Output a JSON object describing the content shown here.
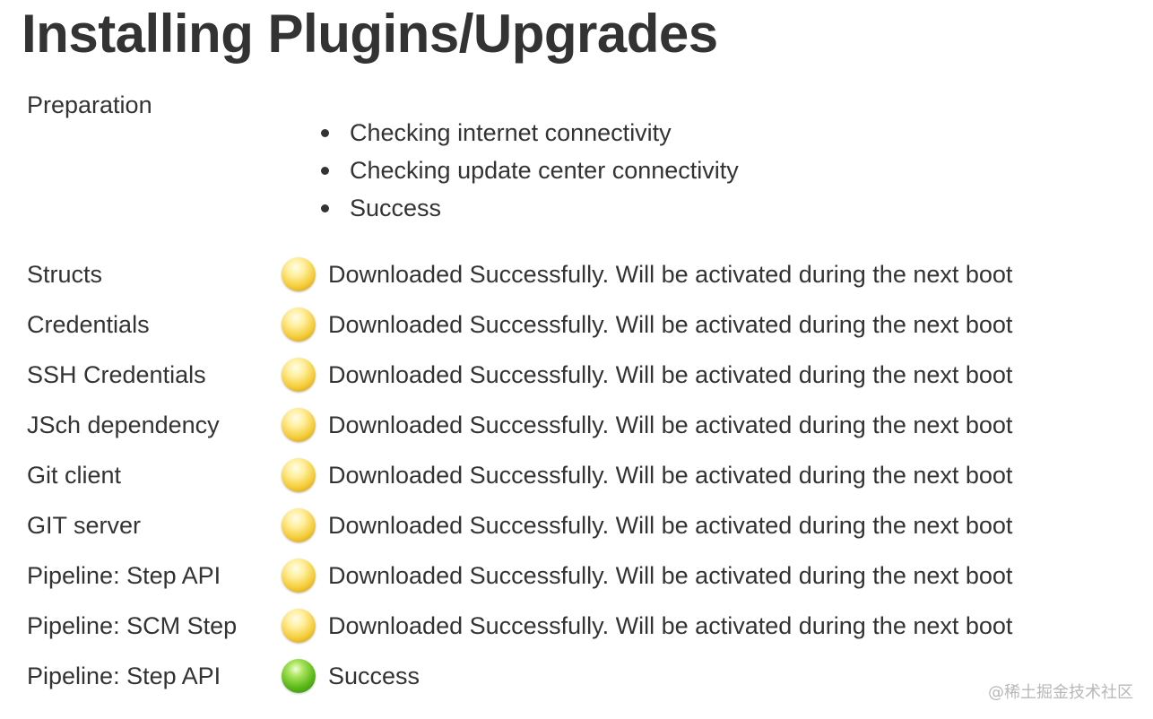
{
  "page": {
    "title": "Installing Plugins/Upgrades"
  },
  "preparation": {
    "label": "Preparation",
    "steps": [
      "Checking internet connectivity",
      "Checking update center connectivity",
      "Success"
    ]
  },
  "plugins": [
    {
      "name": "Structs",
      "status": "Downloaded Successfully. Will be activated during the next boot",
      "icon": "yellow-ball-icon",
      "color": "#f4cd3a"
    },
    {
      "name": "Credentials",
      "status": "Downloaded Successfully. Will be activated during the next boot",
      "icon": "yellow-ball-icon",
      "color": "#f4cd3a"
    },
    {
      "name": "SSH Credentials",
      "status": "Downloaded Successfully. Will be activated during the next boot",
      "icon": "yellow-ball-icon",
      "color": "#f4cd3a"
    },
    {
      "name": "JSch dependency",
      "status": "Downloaded Successfully. Will be activated during the next boot",
      "icon": "yellow-ball-icon",
      "color": "#f4cd3a"
    },
    {
      "name": "Git client",
      "status": "Downloaded Successfully. Will be activated during the next boot",
      "icon": "yellow-ball-icon",
      "color": "#f4cd3a"
    },
    {
      "name": "GIT server",
      "status": "Downloaded Successfully. Will be activated during the next boot",
      "icon": "yellow-ball-icon",
      "color": "#f4cd3a"
    },
    {
      "name": "Pipeline: Step API",
      "status": "Downloaded Successfully. Will be activated during the next boot",
      "icon": "yellow-ball-icon",
      "color": "#f4cd3a"
    },
    {
      "name": "Pipeline: SCM Step",
      "status": "Downloaded Successfully. Will be activated during the next boot",
      "icon": "yellow-ball-icon",
      "color": "#f4cd3a"
    },
    {
      "name": "Pipeline: Step API",
      "status": "Success",
      "icon": "green-ball-icon",
      "color": "#5cb91a"
    }
  ],
  "watermark": {
    "text": "@稀土掘金技术社区"
  }
}
